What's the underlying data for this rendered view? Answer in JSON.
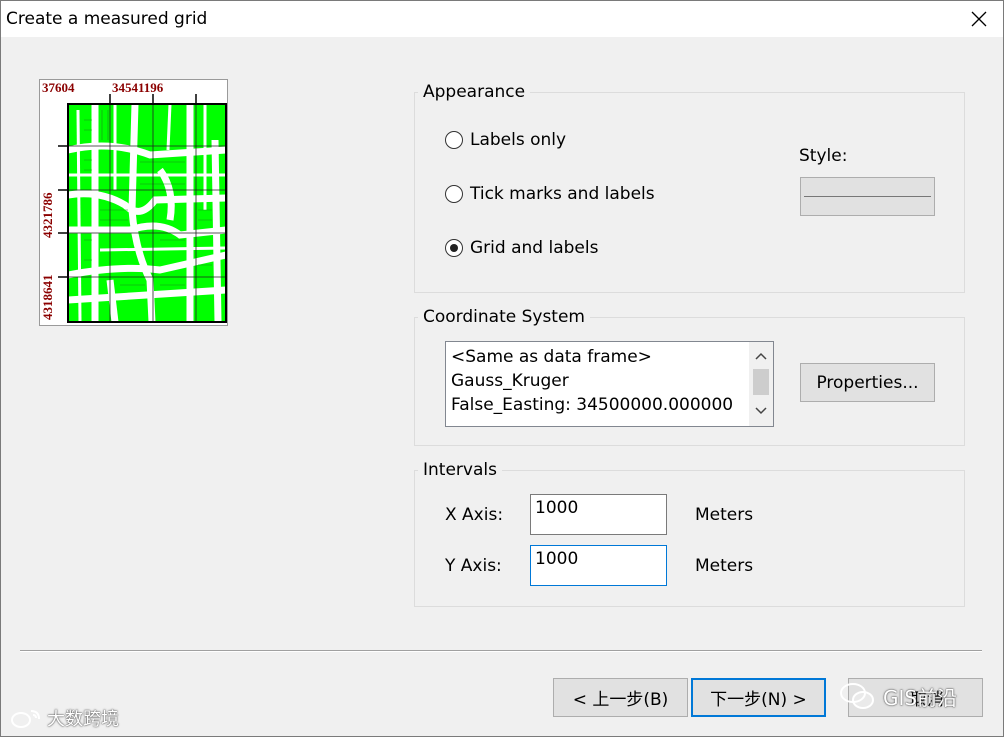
{
  "window": {
    "title": "Create a measured grid"
  },
  "preview": {
    "top_labels": [
      "37604",
      "34541196"
    ],
    "left_labels": [
      "4321786",
      "4318641"
    ],
    "map_fill": "#00ff00"
  },
  "appearance": {
    "legend": "Appearance",
    "options": [
      {
        "label": "Labels only",
        "selected": false
      },
      {
        "label": "Tick marks and labels",
        "selected": false
      },
      {
        "label": "Grid and labels",
        "selected": true
      }
    ],
    "style_label": "Style:"
  },
  "coordinate_system": {
    "legend": "Coordinate System",
    "lines": [
      "<Same as data frame>",
      "Gauss_Kruger",
      "False_Easting: 34500000.000000"
    ],
    "properties_button": "Properties..."
  },
  "intervals": {
    "legend": "Intervals",
    "x_label": "X Axis:",
    "x_value": "1000",
    "x_unit": "Meters",
    "y_label": "Y Axis:",
    "y_value": "1000",
    "y_unit": "Meters"
  },
  "buttons": {
    "back": "< 上一步(B)",
    "next": "下一步(N) >",
    "cancel": "取消"
  },
  "watermarks": {
    "left": "大数跨境",
    "right": "GIS前沿"
  },
  "colors": {
    "accent": "#0078d7",
    "label_red": "#8b0000"
  }
}
